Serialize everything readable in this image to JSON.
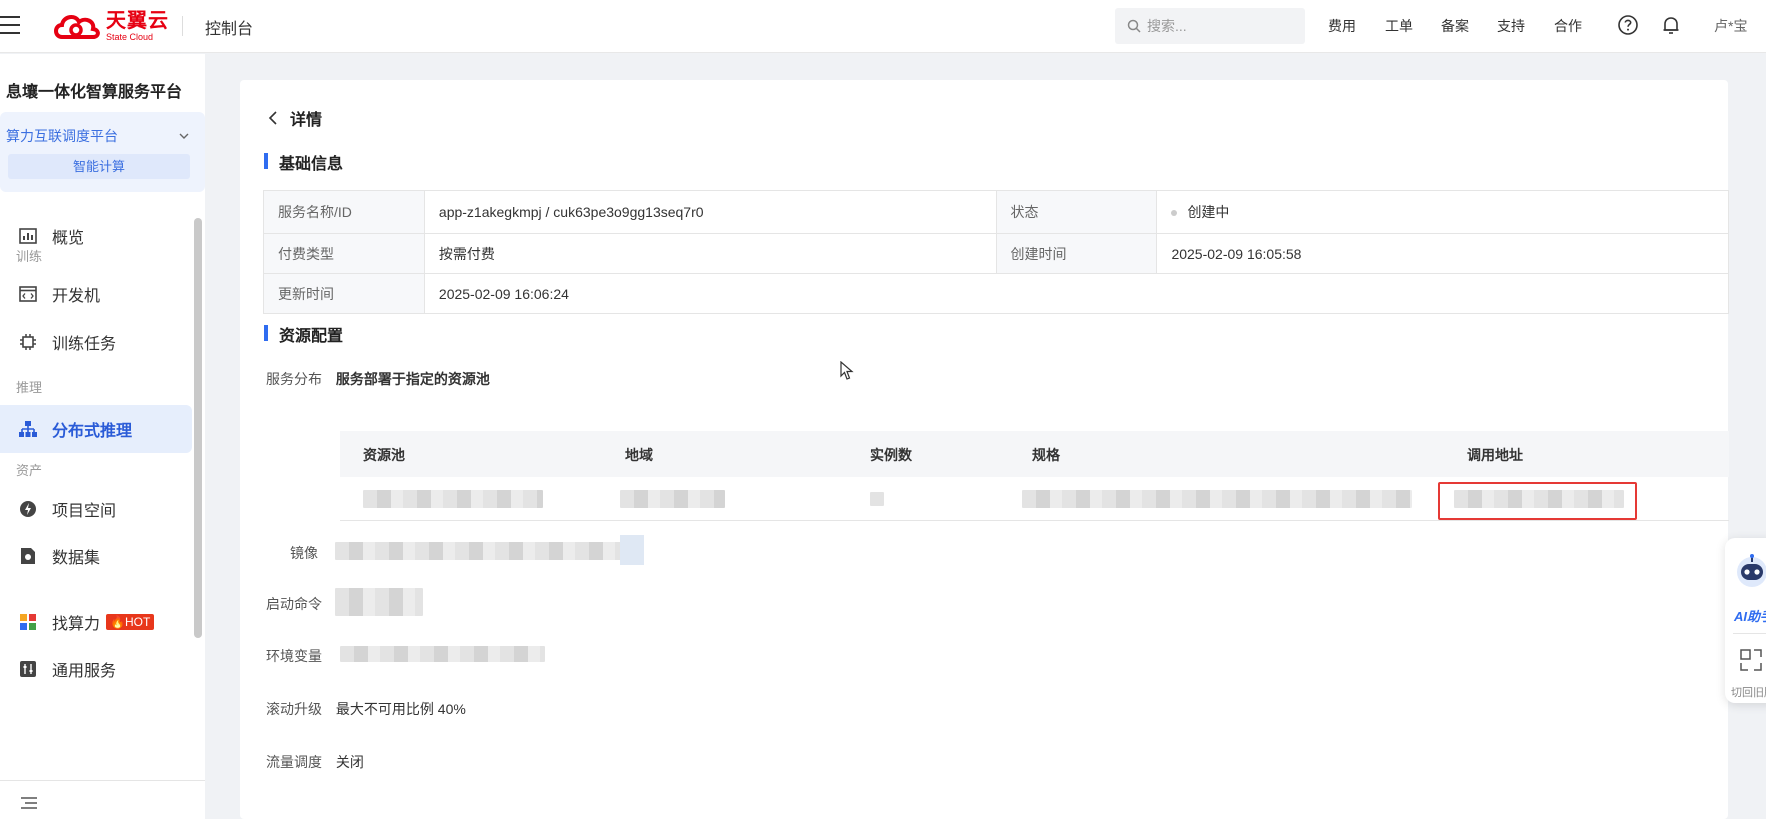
{
  "topbar": {
    "logo_cn": "天翼云",
    "logo_en": "State Cloud",
    "console": "控制台",
    "search_placeholder": "搜索...",
    "nav": [
      "费用",
      "工单",
      "备案",
      "支持",
      "合作"
    ],
    "user": "卢*宝"
  },
  "sidebar": {
    "platform_title": "息壤一体化智算服务平台",
    "selector_label": "算力互联调度平台",
    "selector_tag": "智能计算",
    "items": {
      "overview": "概览",
      "group_train": "训练",
      "devbox": "开发机",
      "train_task": "训练任务",
      "group_infer": "推理",
      "dist_infer": "分布式推理",
      "group_asset": "资产",
      "project": "项目空间",
      "dataset": "数据集",
      "find_compute": "找算力",
      "hot": "HOT",
      "general": "通用服务"
    }
  },
  "detail": {
    "back_label": "详情",
    "basic_title": "基础信息",
    "basic": {
      "name_key": "服务名称/ID",
      "name_val": "app-z1akegkmpj / cuk63pe3o9gg13seq7r0",
      "status_key": "状态",
      "status_val": "创建中",
      "pay_key": "付费类型",
      "pay_val": "按需付费",
      "created_key": "创建时间",
      "created_val": "2025-02-09 16:05:58",
      "updated_key": "更新时间",
      "updated_val": "2025-02-09 16:06:24"
    },
    "resource_title": "资源配置",
    "dist_key": "服务分布",
    "dist_val": "服务部署于指定的资源池",
    "pool_headers": [
      "资源池",
      "地域",
      "实例数",
      "规格",
      "调用地址"
    ],
    "image_key": "镜像",
    "cmd_key": "启动命令",
    "env_key": "环境变量",
    "rolling_key": "滚动升级",
    "rolling_val": "最大不可用比例 40%",
    "traffic_key": "流量调度",
    "traffic_val": "关闭"
  },
  "float": {
    "ai_label": "AI助手",
    "switch_label": "切回旧版"
  },
  "colors": {
    "accent": "#2f6cf0",
    "brand": "#e60012",
    "highlight_box": "#e53935"
  }
}
